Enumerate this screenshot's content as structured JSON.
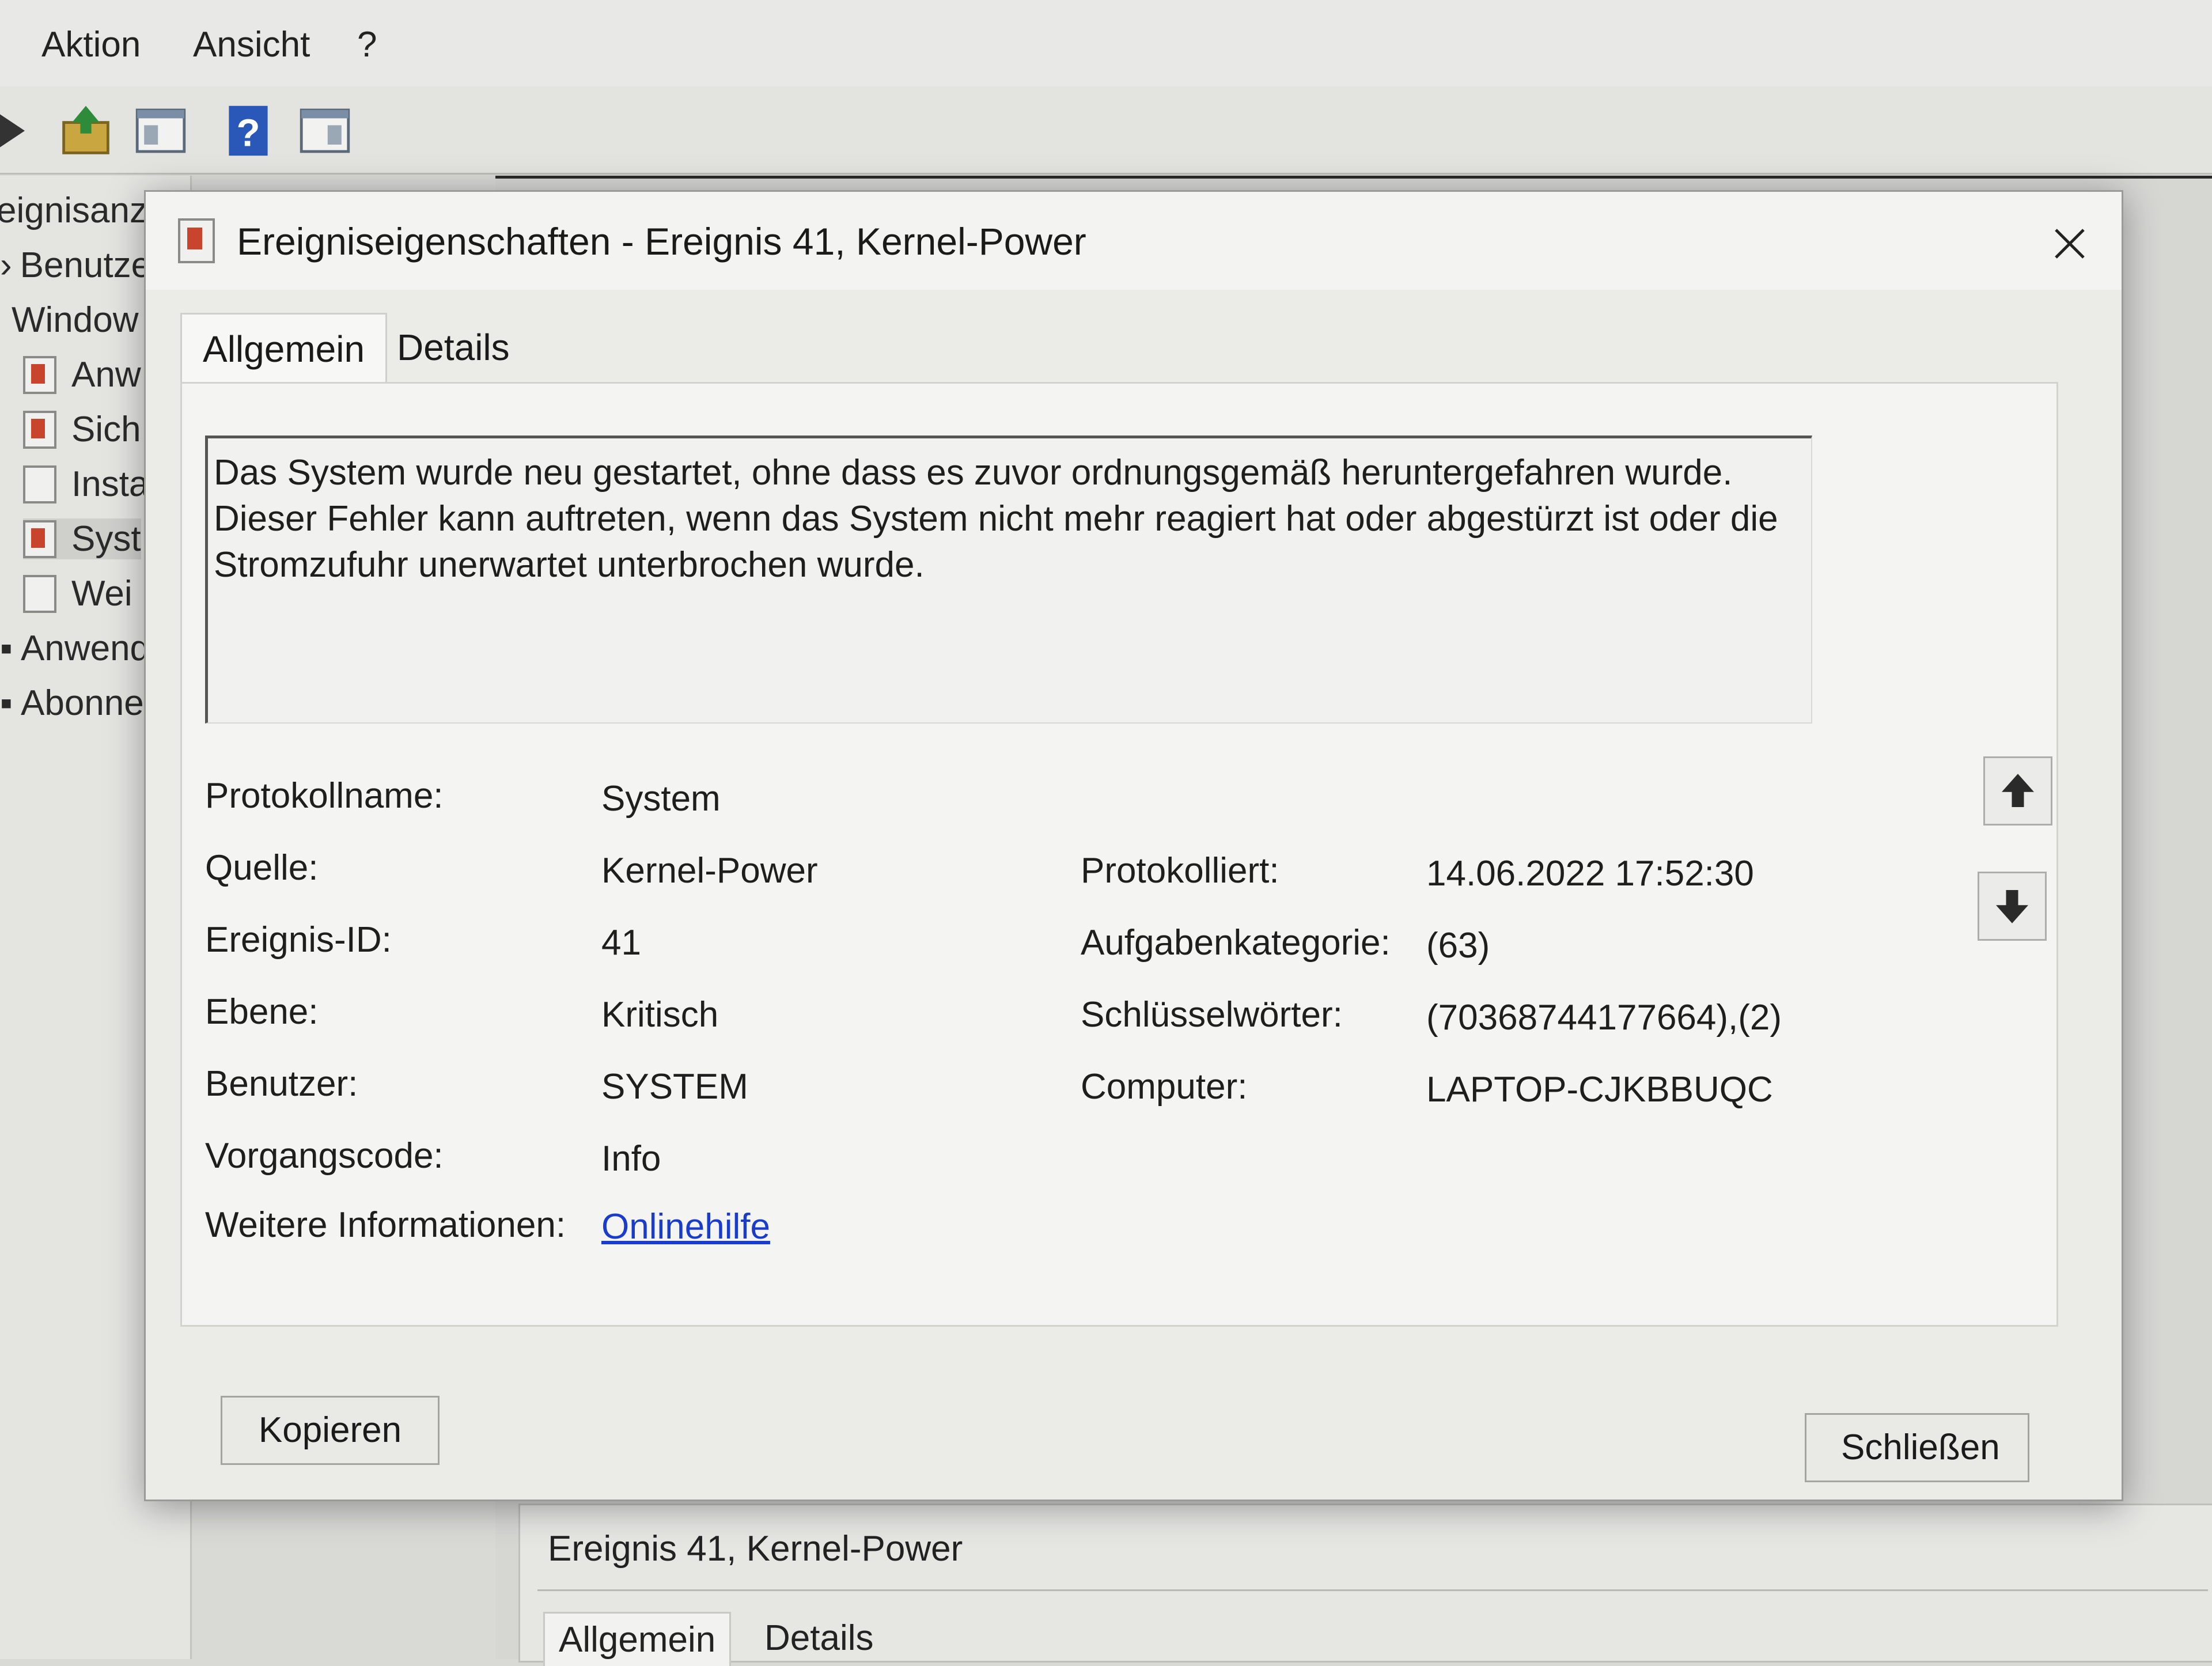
{
  "menubar": {
    "items": [
      "Aktion",
      "Ansicht",
      "?"
    ]
  },
  "toolbar": {
    "buttons": [
      "back-arrow-icon",
      "folder-up-icon",
      "console-tree-icon",
      "help-icon",
      "action-pane-icon"
    ]
  },
  "tree": {
    "items": [
      {
        "label": "eignisanz"
      },
      {
        "label": "Benutze"
      },
      {
        "label": "Window"
      },
      {
        "label": "Anw"
      },
      {
        "label": "Sich"
      },
      {
        "label": "Insta"
      },
      {
        "label": "Syst"
      },
      {
        "label": "Wei"
      },
      {
        "label": "Anwend"
      },
      {
        "label": "Abonne"
      }
    ]
  },
  "dialog": {
    "title": "Ereigniseigenschaften - Ereignis 41, Kernel-Power",
    "close_glyph": "✕",
    "tabs": [
      "Allgemein",
      "Details"
    ],
    "description": "Das System wurde neu gestartet, ohne dass es zuvor ordnungsgemäß heruntergefahren wurde. Dieser Fehler kann auftreten, wenn das System nicht mehr reagiert hat oder abgestürzt ist oder die Stromzufuhr unerwartet unterbrochen wurde.",
    "fields": {
      "protokollname_label": "Protokollname:",
      "protokollname_value": "System",
      "quelle_label": "Quelle:",
      "quelle_value": "Kernel-Power",
      "ereignis_id_label": "Ereignis-ID:",
      "ereignis_id_value": "41",
      "ebene_label": "Ebene:",
      "ebene_value": "Kritisch",
      "benutzer_label": "Benutzer:",
      "benutzer_value": "SYSTEM",
      "vorgangscode_label": "Vorgangscode:",
      "vorgangscode_value": "Info",
      "weitere_label": "Weitere Informationen:",
      "weitere_link": "Onlinehilfe",
      "protokolliert_label": "Protokolliert:",
      "protokolliert_value": "14.06.2022 17:52:30",
      "aufgabenkategorie_label": "Aufgabenkategorie:",
      "aufgabenkategorie_value": "(63)",
      "schluesselwoerter_label": "Schlüsselwörter:",
      "schluesselwoerter_value": "(70368744177664),(2)",
      "computer_label": "Computer:",
      "computer_value": "LAPTOP-CJKBBUQC"
    },
    "buttons": {
      "copy": "Kopieren",
      "close": "Schließen"
    }
  },
  "bottom_panel": {
    "title": "Ereignis 41, Kernel-Power",
    "tabs": [
      "Allgemein",
      "Details"
    ]
  }
}
